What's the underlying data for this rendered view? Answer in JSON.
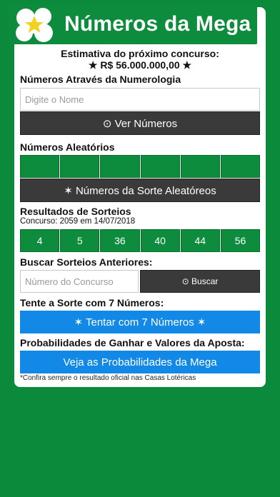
{
  "banner": {
    "title": "Números da Mega"
  },
  "estimate": {
    "label": "Estimativa do próximo concurso:",
    "value": "★ R$ 56.000.000,00 ★"
  },
  "numerology": {
    "label": "Números Através da Numerologia",
    "name_placeholder": "Digite o Nome",
    "button_label": "⊙ Ver Números"
  },
  "random": {
    "label": "Números Aleatórios",
    "cells": [
      "",
      "",
      "",
      "",
      "",
      ""
    ],
    "button_label": "✶ Números da Sorte Aleatóreos"
  },
  "results": {
    "label": "Resultados de Sorteios",
    "contest_info": "Concurso: 2059 em 14/07/2018",
    "numbers": [
      "4",
      "5",
      "36",
      "40",
      "44",
      "56"
    ]
  },
  "search": {
    "label": "Buscar Sorteios Anteriores:",
    "placeholder": "Número do Concurso",
    "button_label": "⊙ Buscar"
  },
  "seven": {
    "label": "Tente a Sorte com 7 Números:",
    "button_label": "✶ Tentar com 7 Números ✶"
  },
  "probabilities": {
    "label": "Probabilidades de Ganhar e Valores da Aposta:",
    "button_label": "Veja as Probabilidades da Mega"
  },
  "footnote": "*Confira sempre o resultado oficial nas Casas Lotéricas",
  "colors": {
    "background": "#0a8a3a",
    "green": "#0c8c3c",
    "dark_button": "#3a3a3a",
    "blue_button": "#1289e6"
  }
}
